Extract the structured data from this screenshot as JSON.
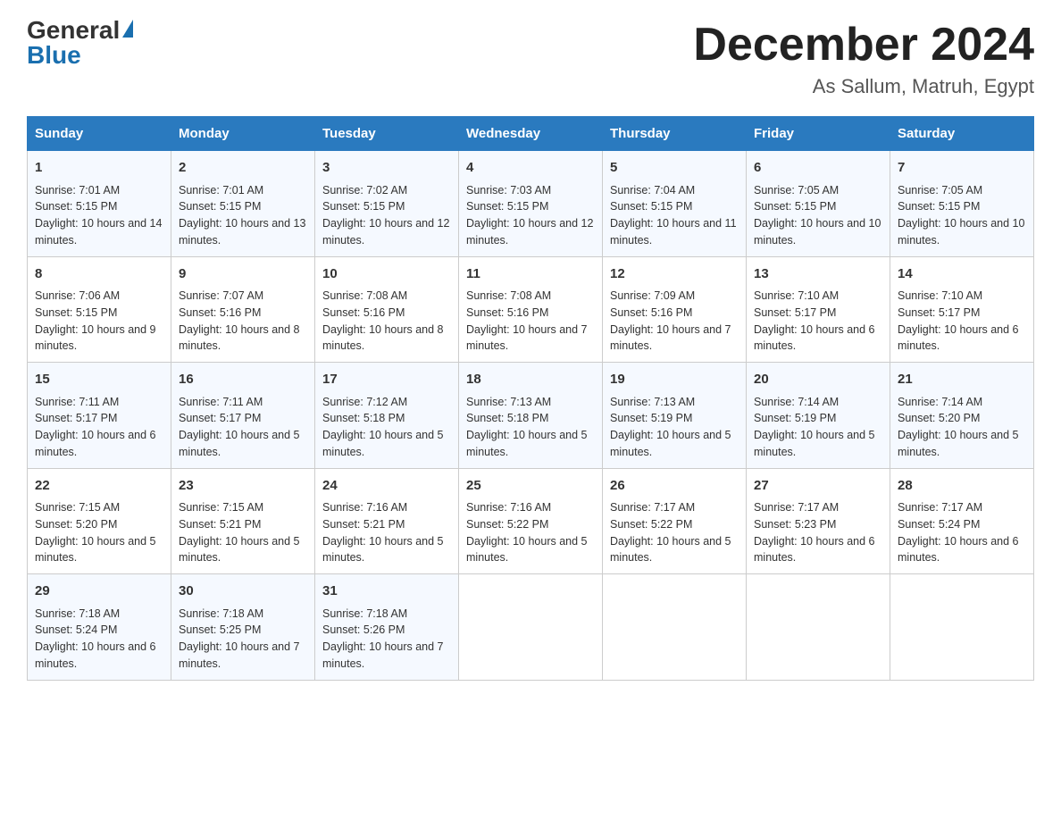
{
  "header": {
    "logo_general": "General",
    "logo_blue": "Blue",
    "month_title": "December 2024",
    "location": "As Sallum, Matruh, Egypt"
  },
  "days_of_week": [
    "Sunday",
    "Monday",
    "Tuesday",
    "Wednesday",
    "Thursday",
    "Friday",
    "Saturday"
  ],
  "weeks": [
    [
      {
        "day": "1",
        "sunrise": "7:01 AM",
        "sunset": "5:15 PM",
        "daylight": "10 hours and 14 minutes."
      },
      {
        "day": "2",
        "sunrise": "7:01 AM",
        "sunset": "5:15 PM",
        "daylight": "10 hours and 13 minutes."
      },
      {
        "day": "3",
        "sunrise": "7:02 AM",
        "sunset": "5:15 PM",
        "daylight": "10 hours and 12 minutes."
      },
      {
        "day": "4",
        "sunrise": "7:03 AM",
        "sunset": "5:15 PM",
        "daylight": "10 hours and 12 minutes."
      },
      {
        "day": "5",
        "sunrise": "7:04 AM",
        "sunset": "5:15 PM",
        "daylight": "10 hours and 11 minutes."
      },
      {
        "day": "6",
        "sunrise": "7:05 AM",
        "sunset": "5:15 PM",
        "daylight": "10 hours and 10 minutes."
      },
      {
        "day": "7",
        "sunrise": "7:05 AM",
        "sunset": "5:15 PM",
        "daylight": "10 hours and 10 minutes."
      }
    ],
    [
      {
        "day": "8",
        "sunrise": "7:06 AM",
        "sunset": "5:15 PM",
        "daylight": "10 hours and 9 minutes."
      },
      {
        "day": "9",
        "sunrise": "7:07 AM",
        "sunset": "5:16 PM",
        "daylight": "10 hours and 8 minutes."
      },
      {
        "day": "10",
        "sunrise": "7:08 AM",
        "sunset": "5:16 PM",
        "daylight": "10 hours and 8 minutes."
      },
      {
        "day": "11",
        "sunrise": "7:08 AM",
        "sunset": "5:16 PM",
        "daylight": "10 hours and 7 minutes."
      },
      {
        "day": "12",
        "sunrise": "7:09 AM",
        "sunset": "5:16 PM",
        "daylight": "10 hours and 7 minutes."
      },
      {
        "day": "13",
        "sunrise": "7:10 AM",
        "sunset": "5:17 PM",
        "daylight": "10 hours and 6 minutes."
      },
      {
        "day": "14",
        "sunrise": "7:10 AM",
        "sunset": "5:17 PM",
        "daylight": "10 hours and 6 minutes."
      }
    ],
    [
      {
        "day": "15",
        "sunrise": "7:11 AM",
        "sunset": "5:17 PM",
        "daylight": "10 hours and 6 minutes."
      },
      {
        "day": "16",
        "sunrise": "7:11 AM",
        "sunset": "5:17 PM",
        "daylight": "10 hours and 5 minutes."
      },
      {
        "day": "17",
        "sunrise": "7:12 AM",
        "sunset": "5:18 PM",
        "daylight": "10 hours and 5 minutes."
      },
      {
        "day": "18",
        "sunrise": "7:13 AM",
        "sunset": "5:18 PM",
        "daylight": "10 hours and 5 minutes."
      },
      {
        "day": "19",
        "sunrise": "7:13 AM",
        "sunset": "5:19 PM",
        "daylight": "10 hours and 5 minutes."
      },
      {
        "day": "20",
        "sunrise": "7:14 AM",
        "sunset": "5:19 PM",
        "daylight": "10 hours and 5 minutes."
      },
      {
        "day": "21",
        "sunrise": "7:14 AM",
        "sunset": "5:20 PM",
        "daylight": "10 hours and 5 minutes."
      }
    ],
    [
      {
        "day": "22",
        "sunrise": "7:15 AM",
        "sunset": "5:20 PM",
        "daylight": "10 hours and 5 minutes."
      },
      {
        "day": "23",
        "sunrise": "7:15 AM",
        "sunset": "5:21 PM",
        "daylight": "10 hours and 5 minutes."
      },
      {
        "day": "24",
        "sunrise": "7:16 AM",
        "sunset": "5:21 PM",
        "daylight": "10 hours and 5 minutes."
      },
      {
        "day": "25",
        "sunrise": "7:16 AM",
        "sunset": "5:22 PM",
        "daylight": "10 hours and 5 minutes."
      },
      {
        "day": "26",
        "sunrise": "7:17 AM",
        "sunset": "5:22 PM",
        "daylight": "10 hours and 5 minutes."
      },
      {
        "day": "27",
        "sunrise": "7:17 AM",
        "sunset": "5:23 PM",
        "daylight": "10 hours and 6 minutes."
      },
      {
        "day": "28",
        "sunrise": "7:17 AM",
        "sunset": "5:24 PM",
        "daylight": "10 hours and 6 minutes."
      }
    ],
    [
      {
        "day": "29",
        "sunrise": "7:18 AM",
        "sunset": "5:24 PM",
        "daylight": "10 hours and 6 minutes."
      },
      {
        "day": "30",
        "sunrise": "7:18 AM",
        "sunset": "5:25 PM",
        "daylight": "10 hours and 7 minutes."
      },
      {
        "day": "31",
        "sunrise": "7:18 AM",
        "sunset": "5:26 PM",
        "daylight": "10 hours and 7 minutes."
      },
      null,
      null,
      null,
      null
    ]
  ]
}
